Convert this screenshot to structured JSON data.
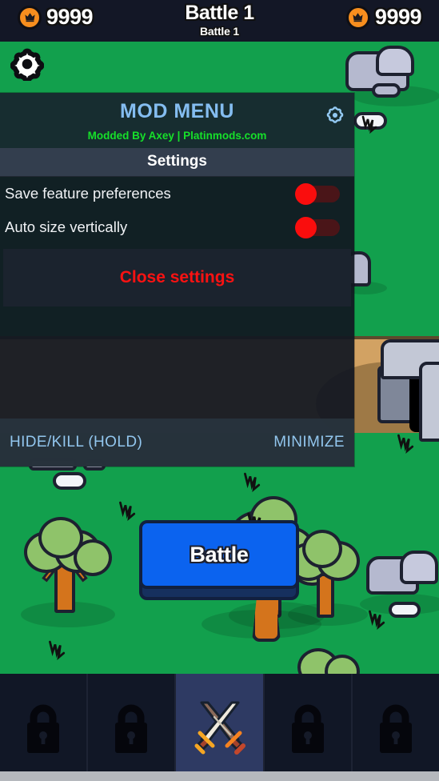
{
  "hud": {
    "currency_left": {
      "icon": "crown-coin-icon",
      "amount": "9999"
    },
    "currency_right": {
      "icon": "crown-coin-icon",
      "amount": "9999"
    },
    "title": "Battle 1",
    "subtitle": "Battle 1"
  },
  "game": {
    "settings_icon": "gear-icon",
    "battle_button_label": "Battle"
  },
  "mod_menu": {
    "title": "MOD MENU",
    "credit": "Modded By Axey | Platinmods.com",
    "gear_icon": "gear-icon",
    "tab_label": "Settings",
    "rows": [
      {
        "label": "Save feature preferences",
        "toggle_on": false
      },
      {
        "label": "Auto size vertically",
        "toggle_on": false
      }
    ],
    "close_label": "Close settings",
    "footer": {
      "hide_kill_label": "HIDE/KILL (HOLD)",
      "minimize_label": "MINIMIZE"
    }
  },
  "bottom_nav": {
    "tabs": [
      {
        "icon": "lock-icon",
        "locked": true,
        "active": false
      },
      {
        "icon": "lock-icon",
        "locked": true,
        "active": false
      },
      {
        "icon": "crossed-swords-icon",
        "locked": false,
        "active": true
      },
      {
        "icon": "lock-icon",
        "locked": true,
        "active": false
      },
      {
        "icon": "lock-icon",
        "locked": true,
        "active": false
      }
    ]
  },
  "colors": {
    "grass": "#12a04d",
    "sand": "#d2a263",
    "hud_bar": "#131726",
    "menu_bg": "#111721",
    "menu_title": "#84bdf0",
    "menu_credit": "#16e02a",
    "close_text": "#fb1212",
    "toggle_off_thumb": "#fa0d0d",
    "battle_blue": "#0b63ef",
    "nav_active": "#2e3a63"
  }
}
